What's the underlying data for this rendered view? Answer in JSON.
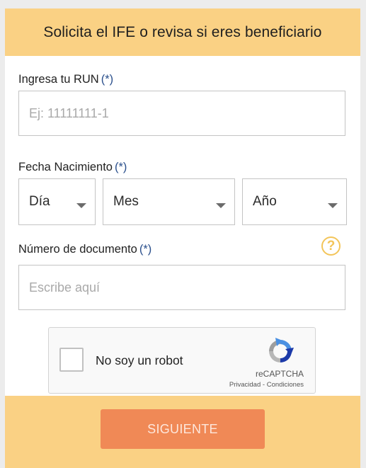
{
  "header": {
    "title": "Solicita el IFE o revisa si eres beneficiario"
  },
  "run": {
    "label": "Ingresa tu RUN",
    "required": "(*)",
    "placeholder": "Ej: 11111111-1",
    "value": ""
  },
  "birthdate": {
    "label": "Fecha Nacimiento",
    "required": "(*)",
    "day": "Día",
    "month": "Mes",
    "year": "Año"
  },
  "document": {
    "label": "Número de documento",
    "required": "(*)",
    "placeholder": "Escribe aquí",
    "value": "",
    "help_icon": "question-circle-icon",
    "help_glyph": "?"
  },
  "captcha": {
    "label": "No soy un robot",
    "brand": "reCAPTCHA",
    "privacy": "Privacidad",
    "separator": " - ",
    "terms": "Condiciones",
    "checked": false
  },
  "submit": {
    "label": "SIGUIENTE"
  },
  "colors": {
    "accent": "#fad184",
    "button": "#f08956",
    "required": "#2a4f8c",
    "help": "#f3c55a"
  }
}
